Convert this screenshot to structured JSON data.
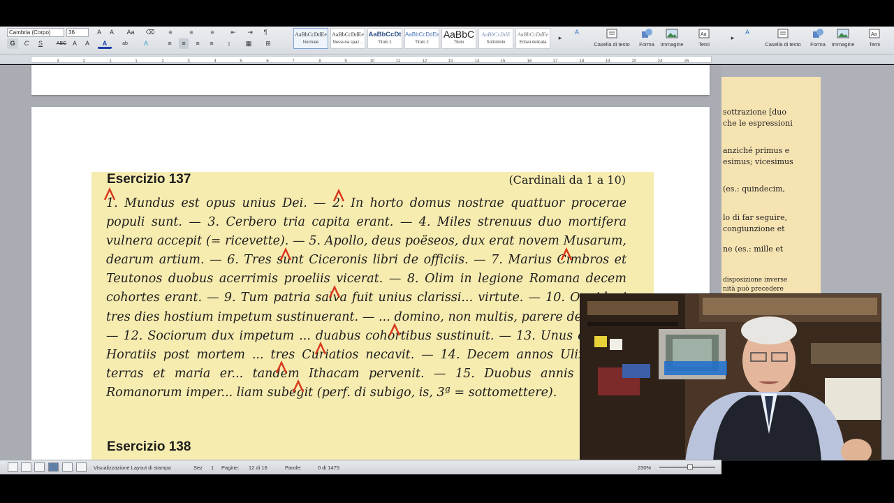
{
  "ribbon": {
    "font_name": "Cambria (Corpo)",
    "font_size": "36",
    "format_buttons": [
      "G",
      "C",
      "S",
      "ABC",
      "A",
      "A"
    ],
    "styles": [
      {
        "sample": "AaBbCcDdEe",
        "name": "Normale"
      },
      {
        "sample": "AaBbCcDdEe",
        "name": "Nessuna spaz..."
      },
      {
        "sample": "AaBbCcDt",
        "name": "Titolo 1"
      },
      {
        "sample": "AaBbCcDdEe",
        "name": "Titolo 2"
      },
      {
        "sample": "AaBbC",
        "name": "Titolo"
      },
      {
        "sample": "AaBbCcDdE",
        "name": "Sottotitolo"
      },
      {
        "sample": "AaBbCcDdEe",
        "name": "Enfasi delicata"
      }
    ],
    "insert_groups": [
      "Casella di testo",
      "Forma",
      "Immagine",
      "Temi"
    ],
    "insert_groups_2": [
      "Casella di testo",
      "Forma",
      "Immagine",
      "Temi"
    ]
  },
  "ruler": {
    "numbers": [
      "3",
      "2",
      "1",
      "1",
      "2",
      "3",
      "4",
      "5",
      "6",
      "7",
      "8",
      "9",
      "10",
      "11",
      "12",
      "13",
      "14",
      "15",
      "16",
      "17",
      "18",
      "19",
      "20",
      "24",
      "26"
    ]
  },
  "document": {
    "exercise_title": "Esercizio 137",
    "exercise_subtitle": "(Cardinali da 1 a 10)",
    "exercise_body": "1. Mundus est opus unius Dei. — 2. In horto domus nostrae quattuor procerae populi sunt. — 3. Cerbero tria capita erant. — 4. Miles strenuus duo mortifera vulnera accepit (= ricevette). — 5. Apollo, deus poëseos, dux erat novem Musarum, dearum artium. — 6. Tres sunt Ciceronis libri de officiis. — 7. Marius Cimbros et Teutonos duobus acerrimis proeliis vicerat. — 8. Olim in legione Romana decem cohortes erant. — 9. Tum patria salva fuit unius clarissi... virtute. — 10. Oppidani tres dies hostium impetum sustinuerant. — ... domino, non multis, parere debemus. — 12. Sociorum dux impetum ... duabus cohortibus sustinuit. — 13. Unus e tribus Horatiis post mortem ... tres Curiatios necavit. — 14. Decem annos Ulixes per terras et maria er... tandem Ithacam pervenit. — 15. Duobus annis Caesar Romanorum imper... liam subegit (perf. di subigo, is, 3ª = sottomettere).",
    "next_exercise_title": "Esercizio 138"
  },
  "side_doc": {
    "lines": [
      "sottrazione [duo",
      "che le espressioni",
      "anziché primus e",
      "esimus; vicesimus",
      "(es.: quindecim,",
      "lo di far seguire,",
      "congiunzione et",
      "ne (es.: mille et",
      "disposizione inverse",
      "nità può precedere"
    ]
  },
  "statusbar": {
    "view_label": "Visualizzazione Layout di stampa",
    "section_label": "Sez",
    "section_value": "1",
    "pages_label": "Pagine:",
    "pages_value": "12 di 16",
    "words_label": "Parole:",
    "words_value": "0 di 1475",
    "zoom": "230%"
  },
  "colors": {
    "scan_background": "#f7ecb0",
    "correction_marks": "#d9381e",
    "ribbon": "#e3e6ea"
  }
}
